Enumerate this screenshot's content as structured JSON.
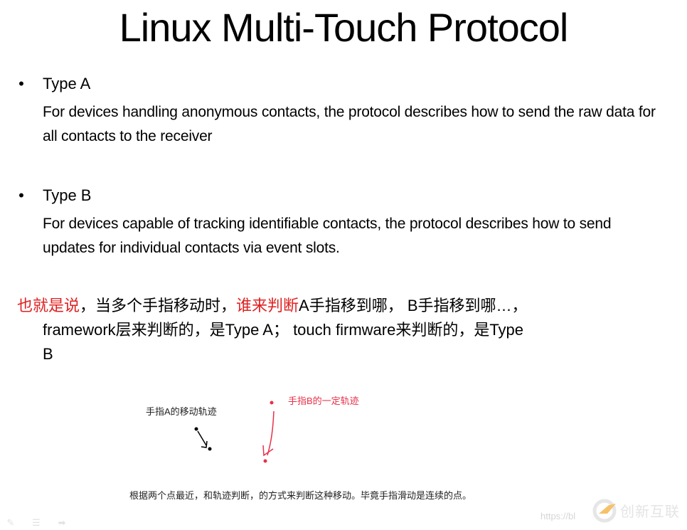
{
  "slide": {
    "title": "Linux Multi-Touch Protocol",
    "bullets": [
      {
        "marker": "•",
        "label": "Type A",
        "description": "For devices handling anonymous contacts, the protocol describes how to send the raw data for all contacts to the receiver"
      },
      {
        "marker": "•",
        "label": "Type B",
        "description": "For devices capable of tracking identifiable contacts, the protocol describes how to send updates for individual contacts via event slots."
      }
    ],
    "summary": {
      "part1_red": "也就是说",
      "part2": "，当多个手指移动时，",
      "part3_red": "谁来判断",
      "part4": "A手指移到哪， B手指移到哪…，",
      "line2": "framework层来判断的，是Type A； touch firmware来判断的，是Type",
      "line3": "B"
    },
    "figure": {
      "finger_a_label": "手指A的移动轨迹",
      "finger_b_label": "手指B的一定轨迹",
      "caption": "根据两个点最近，和轨迹判断，的方式来判断这种移动。毕竟手指滑动是连续的点。"
    },
    "colors": {
      "accent_red": "#e02020",
      "figure_red": "#e8304a"
    }
  },
  "watermark": {
    "url_fragment": "https://bl",
    "brand": "创新互联"
  },
  "nav": {
    "icons": [
      "pen-icon",
      "menu-icon",
      "next-slide-icon"
    ]
  }
}
